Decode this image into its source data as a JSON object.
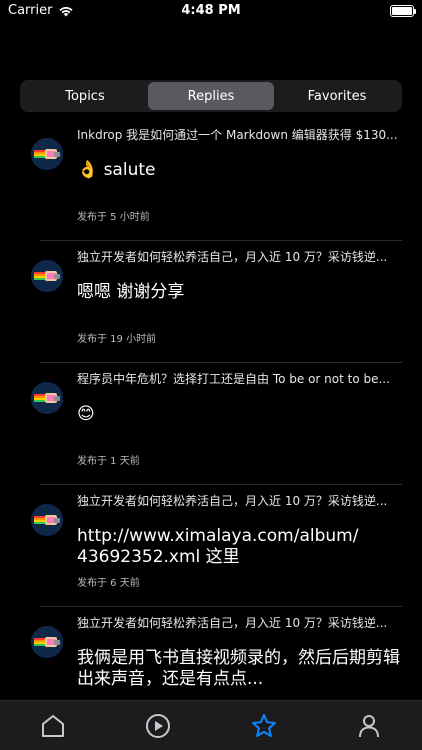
{
  "status": {
    "carrier": "Carrier",
    "time": "4:48 PM"
  },
  "segments": [
    {
      "label": "Topics",
      "active": false
    },
    {
      "label": "Replies",
      "active": true
    },
    {
      "label": "Favorites",
      "active": false
    }
  ],
  "replies": [
    {
      "topic": "Inkdrop 我是如何通过一个 Markdown 编辑器获得 $130...",
      "content": "👌 salute",
      "meta": "发布于 5 小时前"
    },
    {
      "topic": "独立开发者如何轻松养活自己，月入近 10 万？采访钱逆...",
      "content": "嗯嗯 谢谢分享",
      "meta": "发布于 19 小时前"
    },
    {
      "topic": "程序员中年危机？选择打工还是自由 To be or not to be...",
      "content": "😊",
      "meta": "发布于 1 天前"
    },
    {
      "topic": "独立开发者如何轻松养活自己，月入近 10 万？采访钱逆...",
      "content": "http://www.ximalaya.com/album/ 43692352.xml  这里",
      "meta": "发布于 6 天前"
    },
    {
      "topic": "独立开发者如何轻松养活自己，月入近 10 万？采访钱逆...",
      "content": "我俩是用飞书直接视频录的，然后后期剪辑出来声音，还是有点点...",
      "meta": ""
    }
  ],
  "tabbar": [
    {
      "icon": "home-icon",
      "active": false
    },
    {
      "icon": "play-icon",
      "active": false
    },
    {
      "icon": "star-icon",
      "active": true
    },
    {
      "icon": "person-icon",
      "active": false
    }
  ],
  "colors": {
    "accent": "#0a84ff",
    "background": "#000000",
    "tabbar": "#1c1c1e"
  }
}
